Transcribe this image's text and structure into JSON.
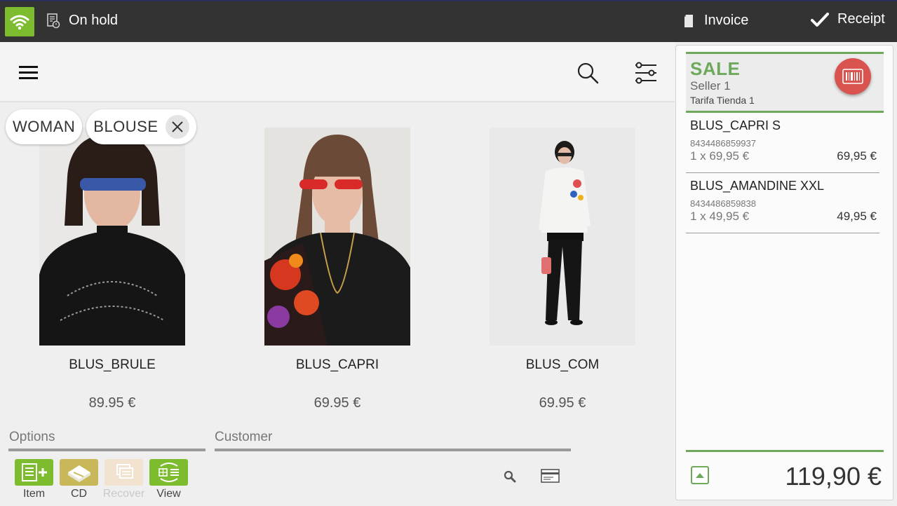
{
  "topbar": {
    "onhold_label": "On hold",
    "invoice_label": "Invoice",
    "receipt_label": "Receipt",
    "wifi_color": "#7dbb2f"
  },
  "filters": {
    "chips": [
      "WOMAN",
      "BLOUSE"
    ]
  },
  "products": [
    {
      "name": "BLUS_BRULE",
      "price": "89.95 €"
    },
    {
      "name": "BLUS_CAPRI",
      "price": "69.95 €"
    },
    {
      "name": "BLUS_COM",
      "price": "69.95 €"
    }
  ],
  "sections": {
    "options_label": "Options",
    "customer_label": "Customer"
  },
  "option_buttons": [
    {
      "label": "Item",
      "icon": "add-item-icon",
      "enabled": true
    },
    {
      "label": "CD",
      "icon": "cd-icon",
      "enabled": true
    },
    {
      "label": "Recover",
      "icon": "recover-icon",
      "enabled": false
    },
    {
      "label": "View",
      "icon": "view-icon",
      "enabled": true
    }
  ],
  "ticket": {
    "type": "SALE",
    "seller": "Seller 1",
    "tarifa": "Tarifa Tienda 1",
    "accent_color": "#6ea85a",
    "lines": [
      {
        "name": "BLUS_CAPRI S",
        "code": "8434486859937",
        "qty": "1 x 69,95 €",
        "total": "69,95 €"
      },
      {
        "name": "BLUS_AMANDINE XXL",
        "code": "8434486859838",
        "qty": "1 x 49,95 €",
        "total": "49,95 €"
      }
    ],
    "total": "119,90 €"
  }
}
